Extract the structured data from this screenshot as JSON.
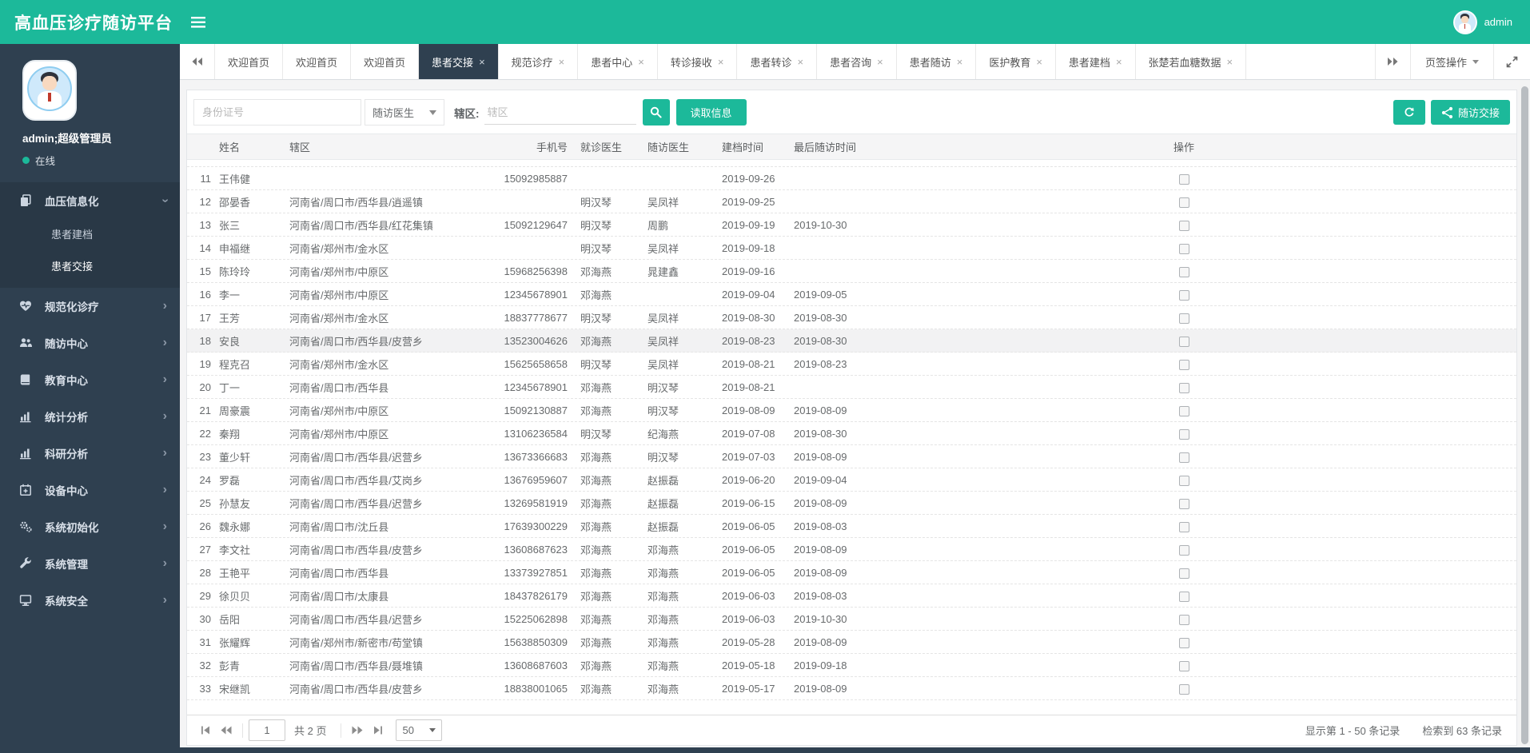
{
  "app": {
    "title": "高血压诊疗随访平台",
    "user_label": "admin"
  },
  "colors": {
    "accent": "#1cb99a",
    "sidebar": "#2f4050",
    "active_tab": "#2f4050"
  },
  "sidebar": {
    "user_name": "admin;超级管理员",
    "status_label": "在线",
    "menu": [
      {
        "id": "bp-info",
        "label": "血压信息化",
        "icon": "copy-icon",
        "expanded": true,
        "children": [
          {
            "id": "patient-file",
            "label": "患者建档"
          },
          {
            "id": "patient-handover",
            "label": "患者交接",
            "active": true
          }
        ]
      },
      {
        "id": "std-treatment",
        "label": "规范化诊疗",
        "icon": "heartbeat-icon"
      },
      {
        "id": "follow-center",
        "label": "随访中心",
        "icon": "users-icon"
      },
      {
        "id": "edu-center",
        "label": "教育中心",
        "icon": "book-icon"
      },
      {
        "id": "stats-analysis",
        "label": "统计分析",
        "icon": "bar-chart-icon"
      },
      {
        "id": "research-analysis",
        "label": "科研分析",
        "icon": "bar-chart-icon"
      },
      {
        "id": "device-center",
        "label": "设备中心",
        "icon": "calendar-plus-icon"
      },
      {
        "id": "sys-init",
        "label": "系统初始化",
        "icon": "cogs-icon"
      },
      {
        "id": "sys-manage",
        "label": "系统管理",
        "icon": "wrench-icon"
      },
      {
        "id": "sys-security",
        "label": "系统安全",
        "icon": "desktop-icon"
      }
    ]
  },
  "tabs": {
    "actions_label": "页签操作",
    "items": [
      {
        "label": "欢迎首页",
        "closable": false
      },
      {
        "label": "欢迎首页",
        "closable": false
      },
      {
        "label": "欢迎首页",
        "closable": false
      },
      {
        "label": "患者交接",
        "closable": true,
        "active": true
      },
      {
        "label": "规范诊疗",
        "closable": true
      },
      {
        "label": "患者中心",
        "closable": true
      },
      {
        "label": "转诊接收",
        "closable": true
      },
      {
        "label": "患者转诊",
        "closable": true
      },
      {
        "label": "患者咨询",
        "closable": true
      },
      {
        "label": "患者随访",
        "closable": true
      },
      {
        "label": "医护教育",
        "closable": true
      },
      {
        "label": "患者建档",
        "closable": true
      },
      {
        "label": "张楚若血糖数据",
        "closable": true
      }
    ]
  },
  "toolbar": {
    "id_placeholder": "身份证号",
    "doctor_select_value": "随访医生",
    "region_label": "辖区:",
    "region_placeholder": "辖区",
    "read_button": "读取信息",
    "handover_button": "随访交接"
  },
  "table": {
    "columns": [
      "",
      "姓名",
      "辖区",
      "手机号",
      "就诊医生",
      "随访医生",
      "建档时间",
      "最后随访时间",
      "操作"
    ],
    "rows": [
      {
        "num": 11,
        "name": "王伟健",
        "region": "",
        "phone": "15092985887",
        "visit_doctor": "",
        "follow_doctor": "",
        "created": "2019-09-26",
        "last_visit": ""
      },
      {
        "num": 12,
        "name": "邵晏香",
        "region": "河南省/周口市/西华县/逍遥镇",
        "phone": "",
        "visit_doctor": "明汉琴",
        "follow_doctor": "吴凤祥",
        "created": "2019-09-25",
        "last_visit": ""
      },
      {
        "num": 13,
        "name": "张三",
        "region": "河南省/周口市/西华县/红花集镇",
        "phone": "15092129647",
        "visit_doctor": "明汉琴",
        "follow_doctor": "周鹏",
        "created": "2019-09-19",
        "last_visit": "2019-10-30"
      },
      {
        "num": 14,
        "name": "申福继",
        "region": "河南省/郑州市/金水区",
        "phone": "",
        "visit_doctor": "明汉琴",
        "follow_doctor": "吴凤祥",
        "created": "2019-09-18",
        "last_visit": ""
      },
      {
        "num": 15,
        "name": "陈玲玲",
        "region": "河南省/郑州市/中原区",
        "phone": "15968256398",
        "visit_doctor": "邓海燕",
        "follow_doctor": "晁建鑫",
        "created": "2019-09-16",
        "last_visit": ""
      },
      {
        "num": 16,
        "name": "李一",
        "region": "河南省/郑州市/中原区",
        "phone": "12345678901",
        "visit_doctor": "邓海燕",
        "follow_doctor": "",
        "created": "2019-09-04",
        "last_visit": "2019-09-05"
      },
      {
        "num": 17,
        "name": "王芳",
        "region": "河南省/郑州市/金水区",
        "phone": "18837778677",
        "visit_doctor": "明汉琴",
        "follow_doctor": "吴凤祥",
        "created": "2019-08-30",
        "last_visit": "2019-08-30"
      },
      {
        "num": 18,
        "name": "安良",
        "region": "河南省/周口市/西华县/皮营乡",
        "phone": "13523004626",
        "visit_doctor": "邓海燕",
        "follow_doctor": "吴凤祥",
        "created": "2019-08-23",
        "last_visit": "2019-08-30",
        "highlight": true
      },
      {
        "num": 19,
        "name": "程克召",
        "region": "河南省/郑州市/金水区",
        "phone": "15625658658",
        "visit_doctor": "明汉琴",
        "follow_doctor": "吴凤祥",
        "created": "2019-08-21",
        "last_visit": "2019-08-23"
      },
      {
        "num": 20,
        "name": "丁一",
        "region": "河南省/周口市/西华县",
        "phone": "12345678901",
        "visit_doctor": "邓海燕",
        "follow_doctor": "明汉琴",
        "created": "2019-08-21",
        "last_visit": ""
      },
      {
        "num": 21,
        "name": "周豪震",
        "region": "河南省/郑州市/中原区",
        "phone": "15092130887",
        "visit_doctor": "邓海燕",
        "follow_doctor": "明汉琴",
        "created": "2019-08-09",
        "last_visit": "2019-08-09"
      },
      {
        "num": 22,
        "name": "秦翔",
        "region": "河南省/郑州市/中原区",
        "phone": "13106236584",
        "visit_doctor": "明汉琴",
        "follow_doctor": "纪海燕",
        "created": "2019-07-08",
        "last_visit": "2019-08-30"
      },
      {
        "num": 23,
        "name": "董少轩",
        "region": "河南省/周口市/西华县/迟营乡",
        "phone": "13673366683",
        "visit_doctor": "邓海燕",
        "follow_doctor": "明汉琴",
        "created": "2019-07-03",
        "last_visit": "2019-08-09"
      },
      {
        "num": 24,
        "name": "罗磊",
        "region": "河南省/周口市/西华县/艾岗乡",
        "phone": "13676959607",
        "visit_doctor": "邓海燕",
        "follow_doctor": "赵振磊",
        "created": "2019-06-20",
        "last_visit": "2019-09-04"
      },
      {
        "num": 25,
        "name": "孙慧友",
        "region": "河南省/周口市/西华县/迟营乡",
        "phone": "13269581919",
        "visit_doctor": "邓海燕",
        "follow_doctor": "赵振磊",
        "created": "2019-06-15",
        "last_visit": "2019-08-09"
      },
      {
        "num": 26,
        "name": "魏永娜",
        "region": "河南省/周口市/沈丘县",
        "phone": "17639300229",
        "visit_doctor": "邓海燕",
        "follow_doctor": "赵振磊",
        "created": "2019-06-05",
        "last_visit": "2019-08-03"
      },
      {
        "num": 27,
        "name": "李文社",
        "region": "河南省/周口市/西华县/皮营乡",
        "phone": "13608687623",
        "visit_doctor": "邓海燕",
        "follow_doctor": "邓海燕",
        "created": "2019-06-05",
        "last_visit": "2019-08-09"
      },
      {
        "num": 28,
        "name": "王艳平",
        "region": "河南省/周口市/西华县",
        "phone": "13373927851",
        "visit_doctor": "邓海燕",
        "follow_doctor": "邓海燕",
        "created": "2019-06-05",
        "last_visit": "2019-08-09"
      },
      {
        "num": 29,
        "name": "徐贝贝",
        "region": "河南省/周口市/太康县",
        "phone": "18437826179",
        "visit_doctor": "邓海燕",
        "follow_doctor": "邓海燕",
        "created": "2019-06-03",
        "last_visit": "2019-08-03"
      },
      {
        "num": 30,
        "name": "岳阳",
        "region": "河南省/周口市/西华县/迟营乡",
        "phone": "15225062898",
        "visit_doctor": "邓海燕",
        "follow_doctor": "邓海燕",
        "created": "2019-06-03",
        "last_visit": "2019-10-30"
      },
      {
        "num": 31,
        "name": "张耀辉",
        "region": "河南省/郑州市/新密市/苟堂镇",
        "phone": "15638850309",
        "visit_doctor": "邓海燕",
        "follow_doctor": "邓海燕",
        "created": "2019-05-28",
        "last_visit": "2019-08-09"
      },
      {
        "num": 32,
        "name": "彭青",
        "region": "河南省/周口市/西华县/聂堆镇",
        "phone": "13608687603",
        "visit_doctor": "邓海燕",
        "follow_doctor": "邓海燕",
        "created": "2019-05-18",
        "last_visit": "2019-09-18"
      },
      {
        "num": 33,
        "name": "宋继凯",
        "region": "河南省/周口市/西华县/皮营乡",
        "phone": "18838001065",
        "visit_doctor": "邓海燕",
        "follow_doctor": "邓海燕",
        "created": "2019-05-17",
        "last_visit": "2019-08-09"
      }
    ]
  },
  "pagination": {
    "page": "1",
    "total_label": "共 2 页",
    "size_value": "50",
    "info_shown": "显示第 1 - 50 条记录",
    "info_total": "检索到 63 条记录"
  }
}
